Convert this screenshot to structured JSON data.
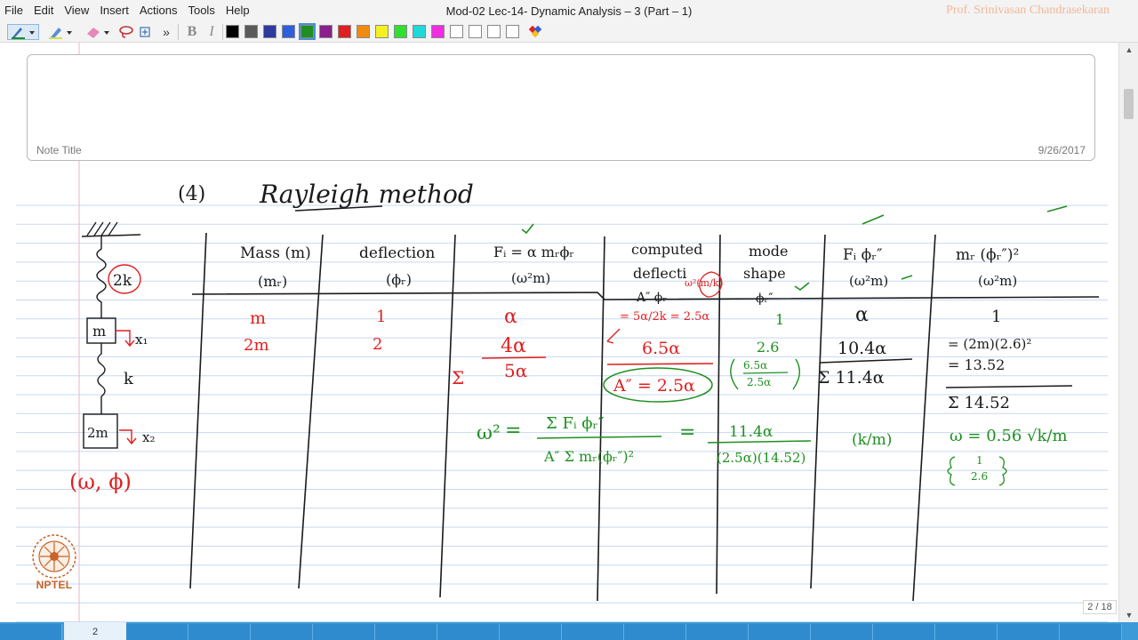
{
  "window": {
    "title": "Mod-02 Lec-14- Dynamic Analysis – 3 (Part – 1)",
    "author": "Prof. Srinivasan Chandrasekaran"
  },
  "menu": [
    "File",
    "Edit",
    "View",
    "Insert",
    "Actions",
    "Tools",
    "Help"
  ],
  "toolbar": {
    "overflow": "»",
    "bold": "B",
    "italic": "I",
    "colors": [
      "#000000",
      "#5a5a5a",
      "#2e3a9e",
      "#2f5fdc",
      "#1f8f1f",
      "#8b1f8b",
      "#e02020",
      "#f08a10",
      "#f5f020",
      "#30e030",
      "#20d8d8",
      "#ef2ee0",
      "#ffffff",
      "#ffffff",
      "#ffffff",
      "#ffffff"
    ],
    "selected_color": "#1f8f1f"
  },
  "note": {
    "title": "Note Title",
    "date": "9/26/2017"
  },
  "page_indicator": "2 / 18",
  "taskbar_page": "2",
  "logo_text": "NPTEL",
  "handwriting": {
    "heading_num": "(4)",
    "heading": "Rayleigh method",
    "model": {
      "spring1": "2k",
      "mass1": "m",
      "disp1": "x₁",
      "spring2": "k",
      "mass2": "2m",
      "disp2": "x₂",
      "unknowns": "(ω, ϕ)"
    },
    "columns": [
      {
        "h1": "Mass (m)",
        "h2": "(mᵣ)"
      },
      {
        "h1": "deflection",
        "h2": "(ϕᵣ)"
      },
      {
        "h1": "Fᵢ = α mᵣϕᵣ",
        "h2": "(ω²m)"
      },
      {
        "h1": "computed",
        "h2": "deflecti",
        "h3": "A″ ϕᵣ"
      },
      {
        "h1": "mode",
        "h2": "shape",
        "h3": "ϕᵣ″"
      },
      {
        "h1": "Fᵢ ϕᵣ″",
        "h2": "(ω²m)"
      },
      {
        "h1": "mᵣ (ϕᵣ″)²",
        "h2": "(ω²m)"
      }
    ],
    "row1": {
      "mass": "m",
      "defl": "1",
      "fi": "α",
      "computed": "= 5α/2k = 2.5α",
      "mode": "1",
      "fiphi": "α",
      "mphi": "1"
    },
    "row2": {
      "mass": "2m",
      "defl": "2",
      "fi": "4α",
      "computed": "6.5α",
      "mode": "2.6",
      "fiphi": "10.4α",
      "mphi1": "= (2m)(2.6)²",
      "mphi2": "= 13.52"
    },
    "sum_fi": "5α",
    "sum_symbol": "Σ",
    "boxed": "A″ = 2.5α",
    "ratio_top": "6.5α",
    "ratio_bottom": "2.5α",
    "sum_fiphi": "Σ 11.4α",
    "sum_mphi": "Σ 14.52",
    "w2": "ω²",
    "eq": "=",
    "formula_num": "Σ Fᵢ ϕᵣ″",
    "formula_den": "A″ Σ mᵣ(ϕᵣ″)²",
    "result_num": "11.4α",
    "result_den": "(2.5α)(14.52)",
    "k_m": "(k/m)",
    "omega": "ω = 0.56 √k/m",
    "mode_vec1": "1",
    "mode_vec2": "2.6",
    "omega_note": "ω²(m/k)"
  }
}
